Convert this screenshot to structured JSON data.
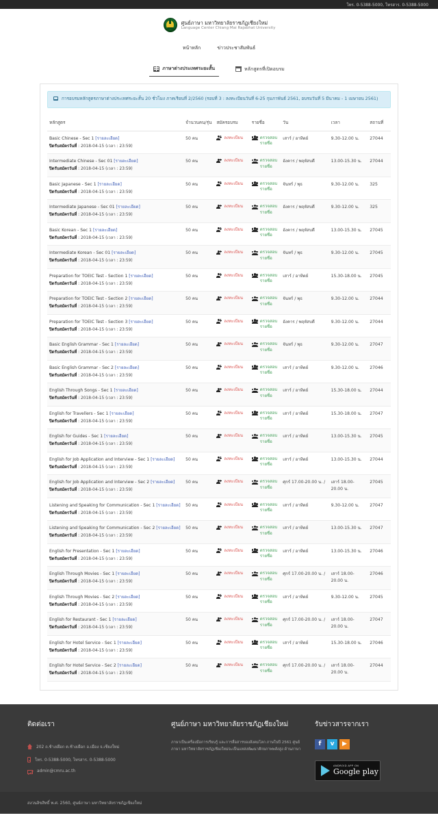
{
  "topbar": {
    "contact": "โทร. 0-5388-5000, โทรสาร. 0-5388-5000"
  },
  "header": {
    "logo_icon": "cmru-emblem-icon",
    "org_th": "ศูนย์ภาษา มหาวิทยาลัยราชภัฏเชียงใหม่",
    "org_en": "Language Center Chiang Mai Rajabhat University",
    "nav": [
      {
        "label": "หน้าหลัก"
      },
      {
        "label": "ข่าวประชาสัมพันธ์"
      }
    ]
  },
  "tabs": [
    {
      "label": "ภาษาต่างประเทศระยะสั้น",
      "icon": "book-icon",
      "active": true
    },
    {
      "label": "หลักสูตรที่เปิดอบรม",
      "icon": "calendar-icon",
      "active": false
    }
  ],
  "alert": {
    "icon": "note-icon",
    "text": "การอบรมหลักสูตรภาษาต่างประเทศระยะสั้น 20 ชั่วโมง ภาคเรียนที่ 2/2560 (รอบที่ 3 : ลงทะเบียนวันที่ 6-25 กุมภาพันธ์ 2561, อบรมวันที่ 5 มีนาคม - 1 เมษายน 2561)"
  },
  "table": {
    "columns": [
      "หลักสูตร",
      "จำนวนคน/รุ่น",
      "สมัครอบรม",
      "รายชื่อ",
      "วัน",
      "เวลา",
      "สถานที่"
    ],
    "register_label": "ลงทะเบียน",
    "checklist_label": "ตรวจสอบรายชื่อ",
    "detail_label": "[รายละเอียด]",
    "closing_label": "ปิดรับสมัครวันที่",
    "closing_value": "2018-04-15 (เวลา : 23:59)",
    "rows": [
      {
        "course": "Basic Chinese - Sec 1",
        "qty": "50 คน",
        "day": "เสาร์ / อาทิตย์",
        "time": "9.30-12.00 น.",
        "room": "27044"
      },
      {
        "course": "Intermediate Chinese - Sec 01",
        "qty": "50 คน",
        "day": "อังคาร / พฤหัสบดี",
        "time": "13.00-15.30 น.",
        "room": "27044"
      },
      {
        "course": "Basic Japanese - Sec 1",
        "qty": "50 คน",
        "day": "จันทร์ / พุธ",
        "time": "9.30-12.00 น.",
        "room": "325"
      },
      {
        "course": "Intermediate Japanese - Sec 01",
        "qty": "50 คน",
        "day": "อังคาร / พฤหัสบดี",
        "time": "9.30-12.00 น.",
        "room": "325"
      },
      {
        "course": "Basic Korean - Sec 1",
        "qty": "50 คน",
        "day": "อังคาร / พฤหัสบดี",
        "time": "13.00-15.30 น.",
        "room": "27045"
      },
      {
        "course": "Intermediate Korean - Sec 01",
        "qty": "50 คน",
        "day": "จันทร์ / พุธ",
        "time": "9.30-12.00 น.",
        "room": "27045"
      },
      {
        "course": "Preparation for TOEIC Test - Section 1",
        "qty": "50 คน",
        "day": "เสาร์ / อาทิตย์",
        "time": "15.30-18.00 น.",
        "room": "27045"
      },
      {
        "course": "Preparation for TOEIC Test - Section 2",
        "qty": "50 คน",
        "day": "จันทร์ / พุธ",
        "time": "9.30-12.00 น.",
        "room": "27044"
      },
      {
        "course": "Preparation for TOEIC Test - Section 3",
        "qty": "50 คน",
        "day": "อังคาร / พฤหัสบดี",
        "time": "9.30-12.00 น.",
        "room": "27044"
      },
      {
        "course": "Basic English Grammar - Sec 1",
        "qty": "50 คน",
        "day": "จันทร์ / พุธ",
        "time": "9.30-12.00 น.",
        "room": "27047"
      },
      {
        "course": "Basic English Grammar - Sec 2",
        "qty": "50 คน",
        "day": "เสาร์ / อาทิตย์",
        "time": "9.30-12.00 น.",
        "room": "27046"
      },
      {
        "course": "English Through Songs - Sec 1",
        "qty": "50 คน",
        "day": "เสาร์ / อาทิตย์",
        "time": "15.30-18.00 น.",
        "room": "27044"
      },
      {
        "course": "English for Travellers - Sec 1",
        "qty": "50 คน",
        "day": "เสาร์ / อาทิตย์",
        "time": "15.30-18.00 น.",
        "room": "27047"
      },
      {
        "course": "English for Guides - Sec 1",
        "qty": "50 คน",
        "day": "เสาร์ / อาทิตย์",
        "time": "13.00-15.30 น.",
        "room": "27045"
      },
      {
        "course": "English for Job Application and Interview - Sec 1",
        "qty": "50 คน",
        "day": "เสาร์ / อาทิตย์",
        "time": "13.00-15.30 น.",
        "room": "27044"
      },
      {
        "course": "English for Job Application and Interview - Sec 2",
        "qty": "50 คน",
        "day": "ศุกร์ 17.00-20.00 น. /",
        "time": "เสาร์ 18.00-20.00 น.",
        "room": "27045"
      },
      {
        "course": "Listening and Speaking for Communication - Sec 1",
        "qty": "50 คน",
        "day": "เสาร์ / อาทิตย์",
        "time": "9.30-12.00 น.",
        "room": "27047"
      },
      {
        "course": "Listening and Speaking for Communication - Sec 2",
        "qty": "50 คน",
        "day": "เสาร์ / อาทิตย์",
        "time": "13.00-15.30 น.",
        "room": "27047"
      },
      {
        "course": "English for Presentation - Sec 1",
        "qty": "50 คน",
        "day": "เสาร์ / อาทิตย์",
        "time": "13.00-15.30 น.",
        "room": "27046"
      },
      {
        "course": "English Through Movies - Sec 1",
        "qty": "50 คน",
        "day": "ศุกร์ 17.00-20.00 น. /",
        "time": "เสาร์ 18.00-20.00 น.",
        "room": "27046"
      },
      {
        "course": "English Through Movies - Sec 2",
        "qty": "50 คน",
        "day": "เสาร์ / อาทิตย์",
        "time": "9.30-12.00 น.",
        "room": "27045"
      },
      {
        "course": "English for Restaurant - Sec 1",
        "qty": "50 คน",
        "day": "ศุกร์ 17.00-20.00 น. /",
        "time": "เสาร์ 18.00-20.00 น.",
        "room": "27047"
      },
      {
        "course": "English for Hotel Service - Sec 1",
        "qty": "50 คน",
        "day": "เสาร์ / อาทิตย์",
        "time": "15.30-18.00 น.",
        "room": "27046"
      },
      {
        "course": "English for Hotel Service - Sec 2",
        "qty": "50 คน",
        "day": "ศุกร์ 17.00-20.00 น. /",
        "time": "เสาร์ 18.00-20.00 น.",
        "room": "27044"
      }
    ]
  },
  "footer": {
    "contact_head": "ติดต่อเรา",
    "address": "202 ถ.ช้างเผือก ต.ช้างเผือก อ.เมือง จ.เชียงใหม่",
    "phone": "โทร. 0-5388-5000, โทรสาร. 0-5388-5000",
    "email": "admin@cmru.ac.th",
    "about_head": "ศูนย์ภาษา มหาวิทยาลัยราชภัฏเชียงใหม่",
    "about_text": "ภาษาเป็นเครื่องมือการเรียนรู้ และการสื่อสารของสังคมโลก ภาษในปี 2561 ศูนย์ภาษา มหาวิทยาลัยราชภัฏเชียงใหม่จะเป็นแหล่งพัฒนาศักยภาพพลังสูง ด้านภาษา",
    "news_head": "รับข่าวสารจากเรา",
    "socials": [
      {
        "name": "facebook-icon",
        "glyph": "f",
        "color": "#3b5998"
      },
      {
        "name": "twitter-icon",
        "glyph": "ᴠ",
        "color": "#2aa9e0"
      },
      {
        "name": "youtube-icon",
        "glyph": "▶",
        "color": "#f08a24"
      }
    ],
    "gplay_small": "ANDROID APP ON",
    "gplay_big": "Google play",
    "copyright": "สงวนลิขสิทธิ์ พ.ศ. 2560, ศูนย์ภาษา มหาวิทยาลัยราชภัฏเชียงใหม่"
  }
}
